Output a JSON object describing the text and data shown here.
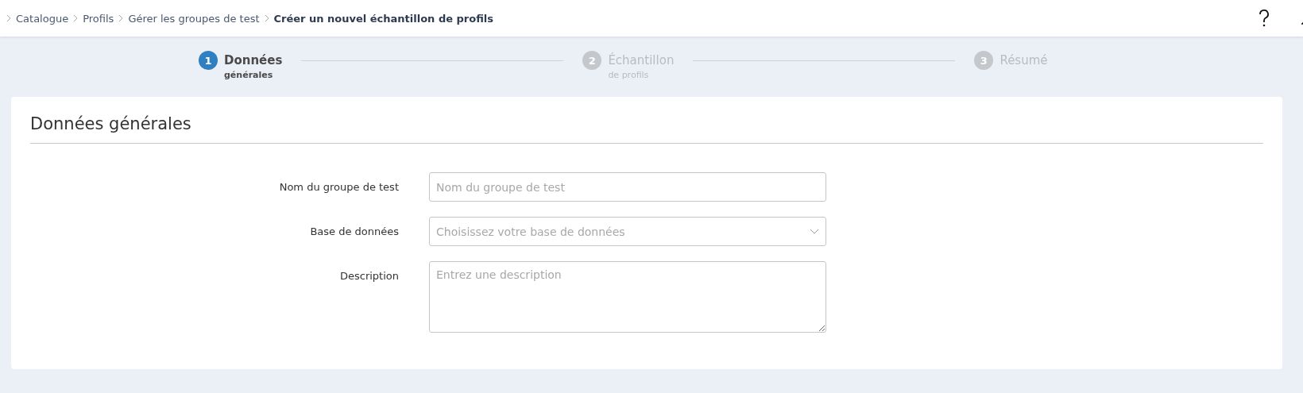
{
  "breadcrumb": [
    {
      "label": "Catalogue",
      "current": false
    },
    {
      "label": "Profils",
      "current": false
    },
    {
      "label": "Gérer les groupes de test",
      "current": false
    },
    {
      "label": "Créer un nouvel échantillon de profils",
      "current": true
    }
  ],
  "steps": [
    {
      "number": "1",
      "title": "Données",
      "subtitle": "générales",
      "selected": true
    },
    {
      "number": "2",
      "title": "Échantillon",
      "subtitle": "de profils",
      "selected": false
    },
    {
      "number": "3",
      "title": "Résumé",
      "selected": false
    }
  ],
  "card": {
    "title": "Données générales",
    "fields": [
      {
        "kind": "text",
        "label": "Nom du groupe de test",
        "placeholder": "Nom du groupe de test"
      },
      {
        "kind": "select",
        "label": "Base de données",
        "placeholder": "Choisissez votre base de données"
      },
      {
        "kind": "textarea",
        "label": "Description",
        "placeholder": "Entrez une description"
      }
    ]
  }
}
